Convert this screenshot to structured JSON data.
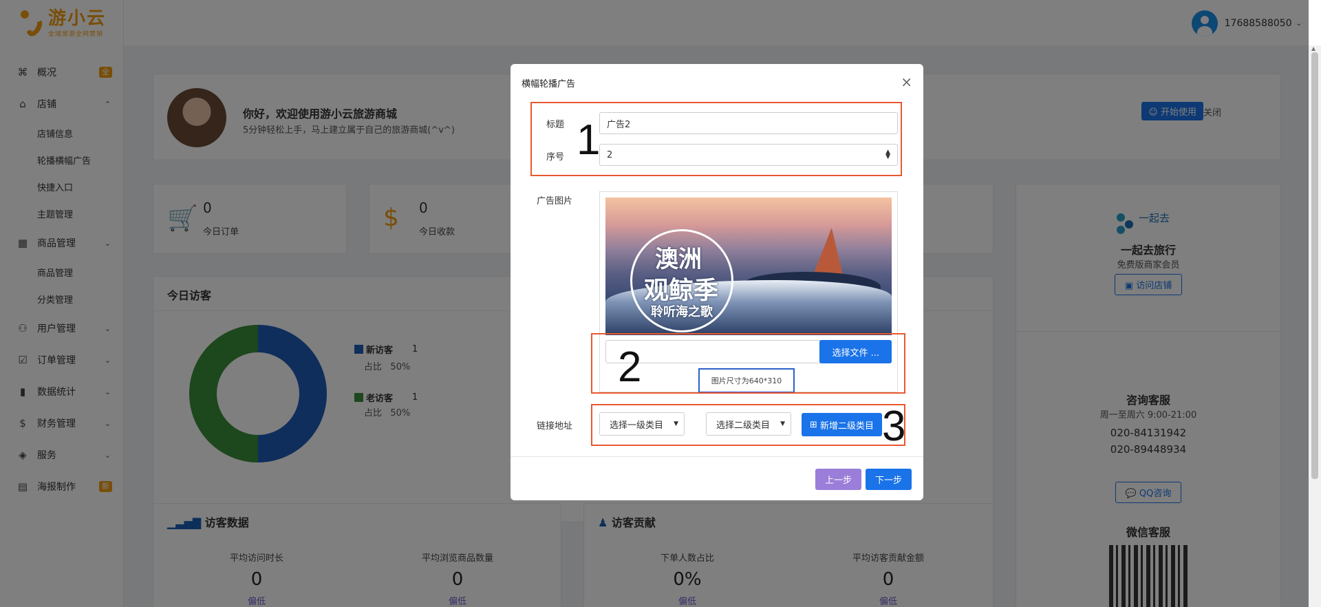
{
  "brand": {
    "name": "游小云",
    "tagline": "全域旅游全网营销"
  },
  "header": {
    "user": "17688588050"
  },
  "sidebar": {
    "items": [
      {
        "icon": "⌘",
        "label": "概况",
        "badge": "全"
      },
      {
        "icon": "⌂",
        "label": "店铺",
        "arrow": "⌃"
      },
      {
        "sub": "店铺信息"
      },
      {
        "sub": "轮播横幅广告"
      },
      {
        "sub": "快捷入口"
      },
      {
        "sub": "主题管理"
      },
      {
        "icon": "▦",
        "label": "商品管理",
        "arrow": "⌄"
      },
      {
        "sub": "商品管理"
      },
      {
        "sub": "分类管理"
      },
      {
        "icon": "⚇",
        "label": "用户管理",
        "arrow": "⌄"
      },
      {
        "icon": "☑",
        "label": "订单管理",
        "arrow": "⌄"
      },
      {
        "icon": "▮",
        "label": "数据统计",
        "arrow": "⌄"
      },
      {
        "icon": "$",
        "label": "财务管理",
        "arrow": "⌄"
      },
      {
        "icon": "◈",
        "label": "服务",
        "arrow": "⌄"
      },
      {
        "icon": "▤",
        "label": "海报制作",
        "badge": "新"
      }
    ]
  },
  "welcome": {
    "title": "你好，欢迎使用游小云旅游商城",
    "subtitle": "5分钟轻松上手，马上建立属于自己的旅游商城(^v^)",
    "start_button": "开始使用",
    "close": "关闭"
  },
  "stats": [
    {
      "icon": "cart-icon",
      "value": "0",
      "label": "今日订单"
    },
    {
      "icon": "dollar-icon",
      "value": "0",
      "label": "今日收款"
    }
  ],
  "visitors": {
    "title": "今日访客",
    "new_label": "新访客",
    "new_value": "1",
    "new_pct_label": "占比",
    "new_pct": "50%",
    "old_label": "老访客",
    "old_value": "1",
    "old_pct_label": "占比",
    "old_pct": "50%",
    "colors": {
      "new": "#1f5db8",
      "old": "#3a8e3a"
    }
  },
  "visit_data": {
    "title": "访客数据",
    "metrics": [
      {
        "label": "平均访问时长",
        "value": "0",
        "rate": "偏低"
      },
      {
        "label": "平均浏览商品数量",
        "value": "0",
        "rate": "偏低"
      }
    ]
  },
  "contribution": {
    "title": "访客贡献",
    "metrics": [
      {
        "label": "下单人数占比",
        "value": "0%",
        "rate": "偏低"
      },
      {
        "label": "平均访客贡献金额",
        "value": "0",
        "rate": "偏低"
      }
    ]
  },
  "shop": {
    "logo_text": "一起去",
    "name": "一起去旅行",
    "level": "免费版商家会员",
    "visit_button": "访问店铺"
  },
  "service": {
    "title": "咨询客服",
    "hours": "周一至周六 9:00-21:00",
    "phone1": "020-84131942",
    "phone2": "020-89448934",
    "qq_button": "QQ咨询",
    "wechat_title": "微信客服"
  },
  "modal": {
    "title": "横幅轮播广告",
    "title_label": "标题",
    "title_value": "广告2",
    "order_label": "序号",
    "order_value": "2",
    "image_label": "广告图片",
    "ad_text_1": "澳洲",
    "ad_text_2": "观鲸季",
    "ad_text_3": "聆听海之歌",
    "file_button": "选择文件 ...",
    "size_note": "图片尺寸为640*310",
    "link_label": "链接地址",
    "select1": "选择一级类目",
    "select2": "选择二级类目",
    "add_button": "新增二级类目",
    "prev": "上一步",
    "next": "下一步"
  },
  "annotations": [
    "1",
    "2",
    "3"
  ]
}
